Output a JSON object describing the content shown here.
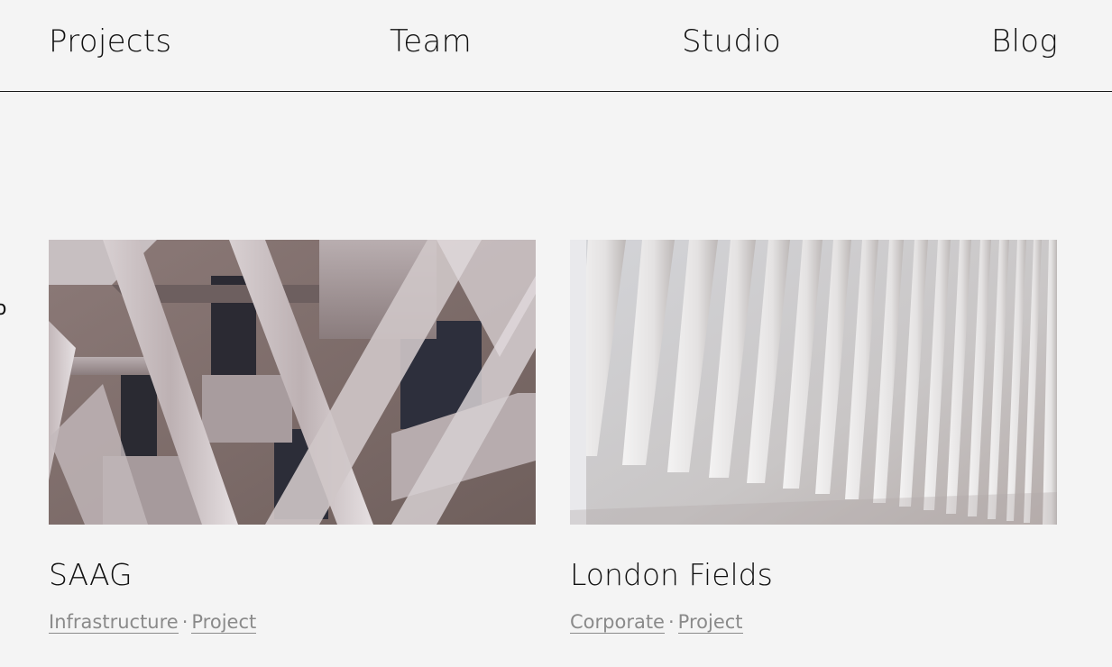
{
  "nav": {
    "items": [
      {
        "label": "Projects"
      },
      {
        "label": "Team"
      },
      {
        "label": "Studio"
      },
      {
        "label": "Blog"
      }
    ]
  },
  "edge_glyph": "o",
  "projects": [
    {
      "title": "SAAG",
      "category": "Infrastructure",
      "separator": "·",
      "type": "Project",
      "image": "building-facade-diagonal-photo"
    },
    {
      "title": "London Fields",
      "category": "Corporate",
      "separator": "·",
      "type": "Project",
      "image": "white-ribbed-ceiling-photo"
    }
  ],
  "colors": {
    "background": "#f4f4f4",
    "text": "#111111",
    "meta_text": "#8a8a8a",
    "divider": "#1a1a1a"
  }
}
